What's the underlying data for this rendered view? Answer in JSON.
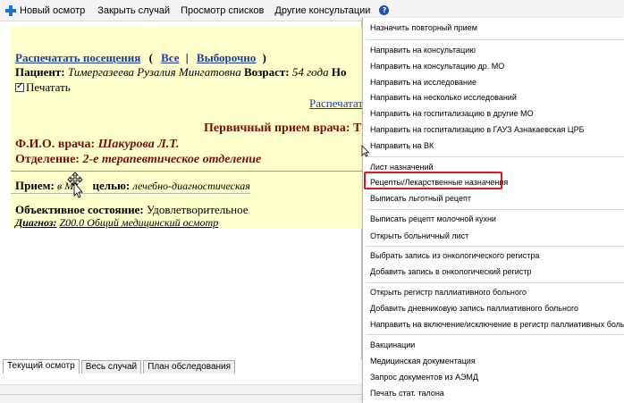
{
  "toolbar": {
    "new_visit": "Новый осмотр",
    "close_case": "Закрыть случай",
    "view_lists": "Просмотр списков",
    "other_consult": "Другие консультации",
    "help_icon": "?"
  },
  "document": {
    "print_visits_link": "Распечатать посещения",
    "paren_open": "(",
    "all_link": "Все",
    "separator": "|",
    "selective_link": "Выборочно",
    "paren_close": ")",
    "patient_label": "Пациент:",
    "patient_name": "Тимергазеева Рузалия Мингатовна",
    "age_label": "Возраст:",
    "age_value": "54 года",
    "cut_label": "Но",
    "print_checkbox_label": "Печатать",
    "print_link_cut": "Распечатат",
    "primary_visit": "Первичный прием врача: Т",
    "doctor_label": "Ф.И.О. врача:",
    "doctor_name": "Шакурова Л.Т.",
    "dept_label": "Отделение:",
    "dept_name": "2-е терапевтическое отделение",
    "reception_label": "Прием:",
    "reception_value": "в М",
    "purpose_label": "целью:",
    "purpose_value": "лечебно-диагностическая",
    "objective_label": "Объективное состояние:",
    "objective_value": "Удовлетворительное",
    "diagnosis_label": "Диагноз:",
    "diagnosis_value": "Z00.0 Общий медицинский осмотр"
  },
  "tabs": [
    "Текущий осмотр",
    "Весь случай",
    "План обследования"
  ],
  "menu": {
    "items": [
      {
        "label": "Назначить повторный прием"
      },
      {
        "label": "Направить на консультацию"
      },
      {
        "label": "Направить на консультацию др. МО"
      },
      {
        "label": "Направить на исследование"
      },
      {
        "label": "Направить на несколько исследований"
      },
      {
        "label": "Направить на госпитализацию в другие МО"
      },
      {
        "label": "Направить на госпитализацию в ГАУЗ Азнакаевская ЦРБ"
      },
      {
        "label": "Направить на ВК"
      },
      {
        "label": "Лист назначений"
      },
      {
        "label": "Рецепты/Лекарственные назначения"
      },
      {
        "label": "Выписать льготный рецепт"
      },
      {
        "label": "Выписать рецепт молочной кухни"
      },
      {
        "label": "Открыть больничный лист"
      },
      {
        "label": "Выбрать запись из онкологического регистра"
      },
      {
        "label": "Добавить запись в онкологический регистр"
      },
      {
        "label": "Открыть регистр паллиативного больного"
      },
      {
        "label": "Добавить дневниковую запись паллиативного больного"
      },
      {
        "label": "Направить на включение/исключение в регистр паллиативных больных"
      },
      {
        "label": "Вакцинации"
      },
      {
        "label": "Медицинская документация"
      },
      {
        "label": "Запрос документов из АЭМД"
      },
      {
        "label": "Печать стат. талона"
      }
    ],
    "highlight_color": "#e0171e"
  }
}
